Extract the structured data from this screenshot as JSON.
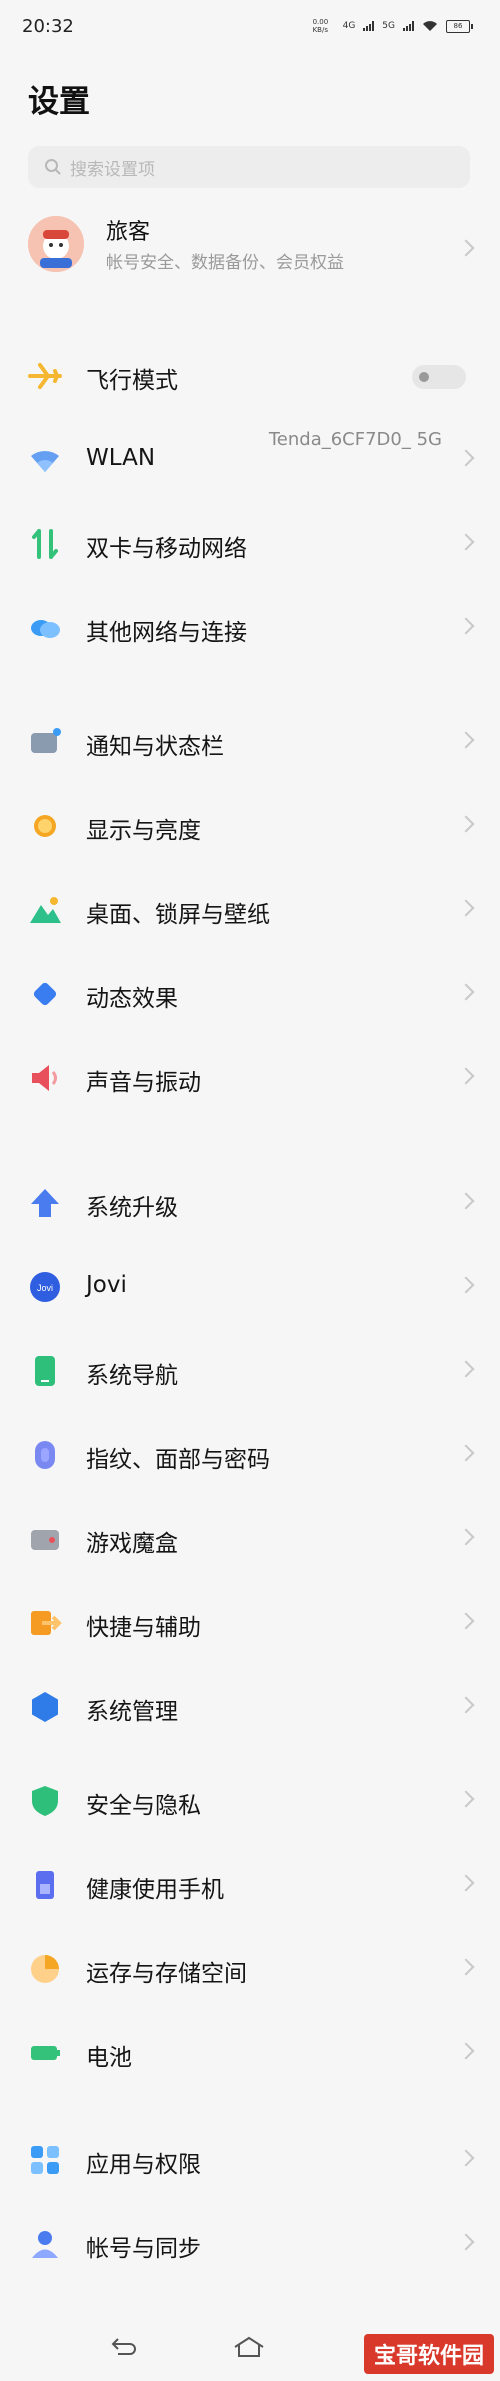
{
  "status_bar": {
    "time": "20:32",
    "net_speed": "0.00 KB/s",
    "sim1": "4G",
    "sim2": "5G",
    "battery": "86"
  },
  "page": {
    "title": "设置"
  },
  "search": {
    "placeholder": "搜索设置项"
  },
  "account": {
    "name": "旅客",
    "subtitle": "帐号安全、数据备份、会员权益"
  },
  "groups": [
    [
      {
        "label": "飞行模式",
        "icon": "airplane-icon",
        "color": "#f5b731",
        "control": "toggle",
        "value": "off"
      },
      {
        "label": "WLAN",
        "icon": "wifi-icon",
        "color": "#4a8ff0",
        "value": "Tenda_6CF7D0_ 5G"
      },
      {
        "label": "双卡与移动网络",
        "icon": "sim-arrows-icon",
        "color": "#34c27a"
      },
      {
        "label": "其他网络与连接",
        "icon": "cloud-link-icon",
        "color": "#3b9cf5"
      }
    ],
    [
      {
        "label": "通知与状态栏",
        "icon": "notification-icon",
        "color": "#8a9bb0"
      },
      {
        "label": "显示与亮度",
        "icon": "sun-icon",
        "color": "#f5a623"
      },
      {
        "label": "桌面、锁屏与壁纸",
        "icon": "mountain-icon",
        "color": "#2ec08a"
      },
      {
        "label": "动态效果",
        "icon": "diamond-icon",
        "color": "#3a7df0"
      },
      {
        "label": "声音与振动",
        "icon": "speaker-icon",
        "color": "#e8505b"
      }
    ],
    [
      {
        "label": "系统升级",
        "icon": "up-arrow-icon",
        "color": "#4a7cf0"
      },
      {
        "label": "Jovi",
        "icon": "jovi-icon",
        "color": "#2f5fe0"
      },
      {
        "label": "系统导航",
        "icon": "phone-nav-icon",
        "color": "#2ec07a"
      },
      {
        "label": "指纹、面部与密码",
        "icon": "fingerprint-icon",
        "color": "#5b6ef0"
      },
      {
        "label": "游戏魔盒",
        "icon": "game-box-icon",
        "color": "#a0a4ad"
      },
      {
        "label": "快捷与辅助",
        "icon": "shortcut-icon",
        "color": "#f59a23"
      },
      {
        "label": "系统管理",
        "icon": "hexagon-icon",
        "color": "#2f7be8"
      }
    ],
    [
      {
        "label": "安全与隐私",
        "icon": "shield-icon",
        "color": "#2ec07a"
      },
      {
        "label": "健康使用手机",
        "icon": "hourglass-icon",
        "color": "#5b6ef0"
      },
      {
        "label": "运存与存储空间",
        "icon": "pie-icon",
        "color": "#f5a623"
      },
      {
        "label": "电池",
        "icon": "battery-icon",
        "color": "#34c27a"
      }
    ],
    [
      {
        "label": "应用与权限",
        "icon": "apps-icon",
        "color": "#3b9cf5"
      },
      {
        "label": "帐号与同步",
        "icon": "person-icon",
        "color": "#4a7cf0"
      }
    ]
  ],
  "watermark": "宝哥软件园"
}
